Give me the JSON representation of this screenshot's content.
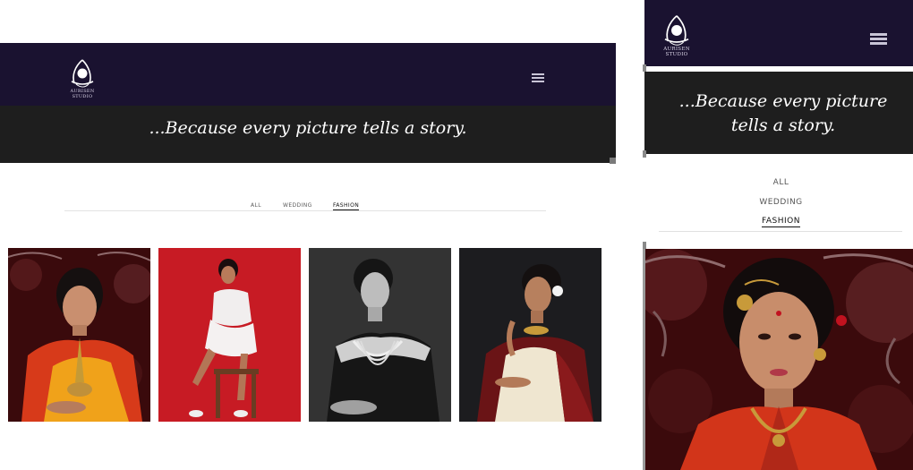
{
  "brand": {
    "name": "AURISEN STUDIO",
    "nav_color": "#1a1230",
    "banner_color": "#1e1e1e"
  },
  "banner": {
    "tagline": "...Because every picture tells a story."
  },
  "desktop": {
    "filters": [
      {
        "label": "ALL",
        "active": false
      },
      {
        "label": "WEDDING",
        "active": false
      },
      {
        "label": "FASHION",
        "active": true
      }
    ],
    "gallery": [
      {
        "subject": "bride-in-orange-saree",
        "icon": "photo-icon"
      },
      {
        "subject": "model-white-dress-red-backdrop",
        "icon": "photo-icon"
      },
      {
        "subject": "monochrome-portrait-pearl-necklace",
        "icon": "photo-icon"
      },
      {
        "subject": "woman-in-cream-saree",
        "icon": "photo-icon"
      }
    ]
  },
  "mobile": {
    "filters": [
      {
        "label": "ALL",
        "active": false
      },
      {
        "label": "WEDDING",
        "active": false
      },
      {
        "label": "FASHION",
        "active": true
      }
    ],
    "featured": {
      "subject": "bride-close-up-portrait",
      "icon": "photo-icon"
    }
  },
  "icons": {
    "logo": "aurisen-logo-icon",
    "menu": "hamburger-menu-icon"
  }
}
